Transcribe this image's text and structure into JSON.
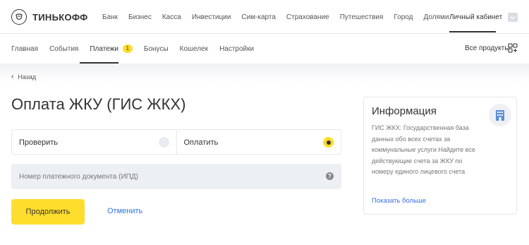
{
  "brand": {
    "name": "ТИНЬКОФФ"
  },
  "topnav": {
    "items": [
      "Банк",
      "Бизнес",
      "Касса",
      "Инвестиции",
      "Сим-карта",
      "Страхование",
      "Путешествия",
      "Город",
      "Долями"
    ],
    "cabinet": "Личный кабинет"
  },
  "subnav": {
    "items": [
      {
        "label": "Главная"
      },
      {
        "label": "События"
      },
      {
        "label": "Платежи",
        "badge": "1",
        "active": true
      },
      {
        "label": "Бонусы"
      },
      {
        "label": "Кошелек"
      },
      {
        "label": "Настройки"
      }
    ],
    "all_products": "Все продукты"
  },
  "back": {
    "label": "Назад"
  },
  "page": {
    "title": "Оплата ЖКУ (ГИС ЖКХ)"
  },
  "options": {
    "check": "Проверить",
    "pay": "Оплатить",
    "selected": "pay"
  },
  "document_field": {
    "placeholder": "Номер платежного документа (ИПД)"
  },
  "actions": {
    "continue": "Продолжить",
    "cancel": "Отменить"
  },
  "info": {
    "title": "Информация",
    "text": "ГИС ЖКХ: Государственная база данных обо всех счетах за коммунальные услуги Найдите все действующие счета за ЖКУ по номеру единого лицевого счета",
    "more": "Показать больше"
  },
  "colors": {
    "accent": "#ffdd2d",
    "link": "#336fee",
    "text": "#333333"
  }
}
